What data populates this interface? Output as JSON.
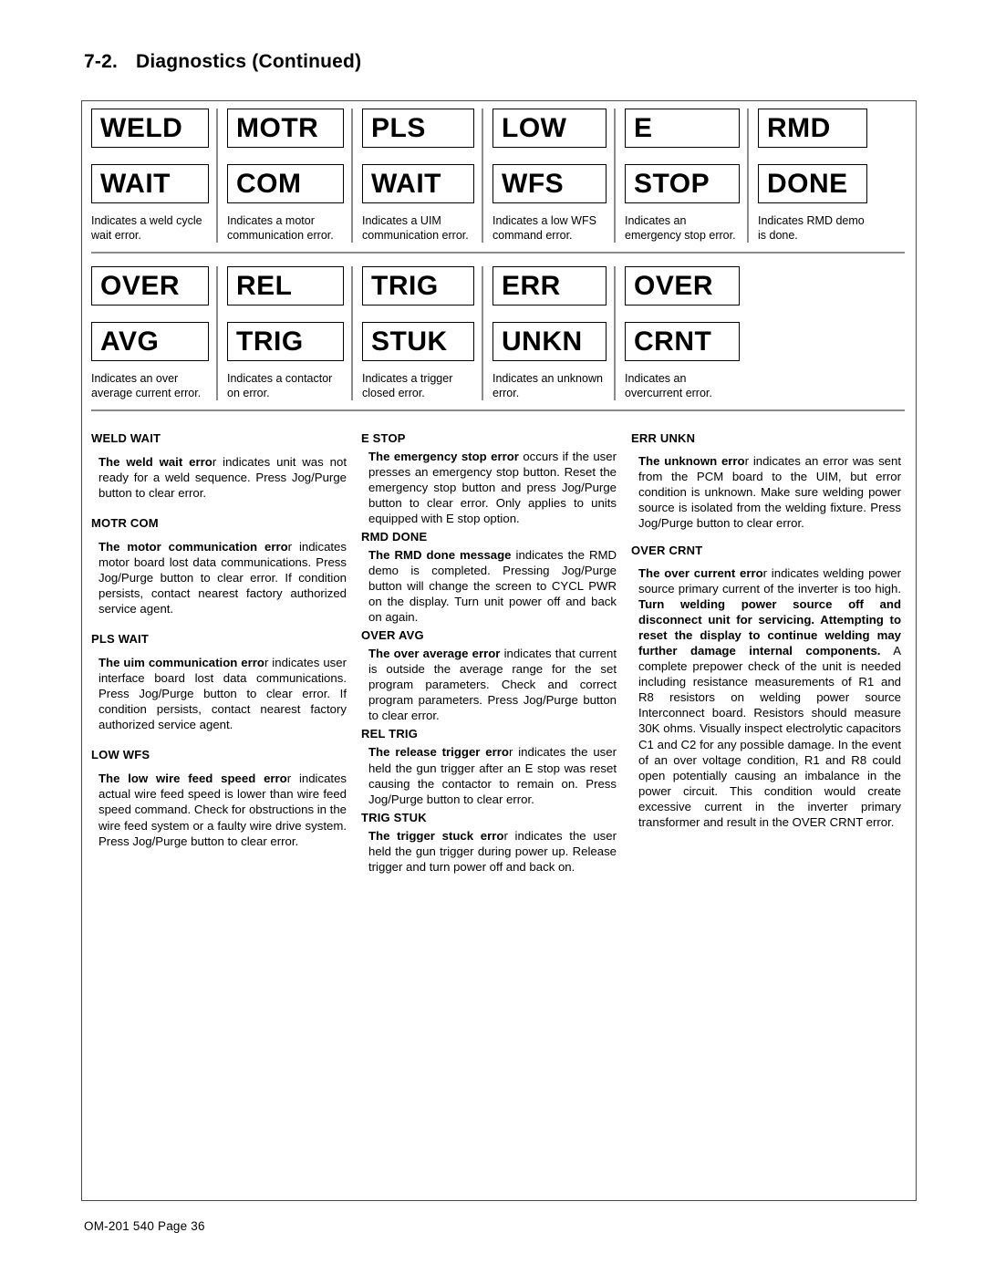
{
  "heading": {
    "number": "7-2.",
    "title": "Diagnostics (Continued)"
  },
  "diagram": {
    "row1": [
      {
        "line1": "WELD",
        "line2": "WAIT",
        "caption": "Indicates a weld cycle wait error."
      },
      {
        "line1": "MOTR",
        "line2": "COM",
        "caption": "Indicates a motor communication error."
      },
      {
        "line1": "PLS",
        "line2": "WAIT",
        "caption": "Indicates a UIM communication error."
      },
      {
        "line1": "LOW",
        "line2": "WFS",
        "caption": "Indicates a low WFS command error."
      },
      {
        "line1": "E",
        "line2": "STOP",
        "caption": "Indicates an emergency stop error."
      },
      {
        "line1": "RMD",
        "line2": "DONE",
        "caption": "Indicates RMD demo is done."
      }
    ],
    "row2": [
      {
        "line1": "OVER",
        "line2": "AVG",
        "caption": "Indicates an over average current error."
      },
      {
        "line1": "REL",
        "line2": "TRIG",
        "caption": "Indicates a contactor on error."
      },
      {
        "line1": "TRIG",
        "line2": "STUK",
        "caption": "Indicates a trigger closed error."
      },
      {
        "line1": "ERR",
        "line2": "UNKN",
        "caption": "Indicates an unknown error."
      },
      {
        "line1": "OVER",
        "line2": "CRNT",
        "caption": "Indicates an overcurrent error."
      }
    ]
  },
  "columns": {
    "col1": [
      {
        "title": "WELD WAIT",
        "lead": "The weld wait erro",
        "rest": "r indicates unit was not ready for a weld sequence. Press Jog/Purge button to clear error."
      },
      {
        "title": "MOTR COM",
        "lead": "The motor communication erro",
        "rest": "r indicates motor board lost data communications. Press Jog/Purge button to clear error. If condition persists, contact nearest factory authorized service agent."
      },
      {
        "title": "PLS WAIT",
        "lead": "The uim communication erro",
        "rest": "r indicates user interface board lost data communications. Press Jog/Purge button to clear error. If condition persists, contact nearest factory authorized service agent."
      },
      {
        "title": "LOW WFS",
        "lead": "The low wire feed speed erro",
        "rest": "r indicates actual wire feed speed is lower than wire feed speed command. Check for obstructions in the wire feed system or a faulty wire drive system. Press Jog/Purge button to clear error."
      }
    ],
    "col2": [
      {
        "title": "E STOP",
        "lead": "The emergency stop error",
        "rest": " occurs if the user presses an emergency stop button. Reset the emergency stop button and press Jog/Purge button to clear error. Only applies to units equipped with E stop option."
      },
      {
        "title": "RMD DONE",
        "lead": "The RMD done message",
        "rest": " indicates the RMD demo is completed. Pressing Jog/Purge button will change the screen to CYCL PWR on the display. Turn unit power off and back on again."
      },
      {
        "title": "OVER AVG",
        "lead": "The over average error",
        "rest": " indicates that current is outside the average range for the set program parameters. Check and correct program parameters. Press Jog/Purge button to clear error."
      },
      {
        "title": "REL TRIG",
        "lead": "The release trigger erro",
        "rest": "r indicates the user held the gun trigger after an E stop was reset causing the contactor to remain on. Press Jog/Purge button to clear error."
      },
      {
        "title": "TRIG STUK",
        "lead": "The trigger stuck erro",
        "rest": "r indicates the user held the gun trigger during power up. Release trigger and turn power off and back on."
      }
    ],
    "col3": [
      {
        "title": "ERR UNKN",
        "lead": "The unknown erro",
        "rest": "r indicates an error was sent from the PCM board to the UIM, but error condition is unknown. Make sure welding power source is isolated from the welding fixture. Press Jog/Purge button to clear error."
      },
      {
        "title": "OVER CRNT",
        "lead": "The over current erro",
        "mid": "r indicates welding power source primary current of the inverter is too high. ",
        "warning": "Turn welding power source off and disconnect unit for servicing. Attempting to reset the display to continue welding may further damage internal components.",
        "rest": " A complete prepower check of the unit is needed including resistance measurements of R1 and R8 resistors on welding power source Interconnect board. Resistors should measure 30K ohms. Visually inspect electrolytic capacitors C1 and C2 for any possible damage. In the event of an over voltage condition, R1 and R8 could open potentially causing an imbalance in the power circuit. This condition would create excessive current in the inverter primary transformer and result in the OVER CRNT error."
      }
    ]
  },
  "footer": {
    "text": "OM-201 540 Page 36"
  }
}
